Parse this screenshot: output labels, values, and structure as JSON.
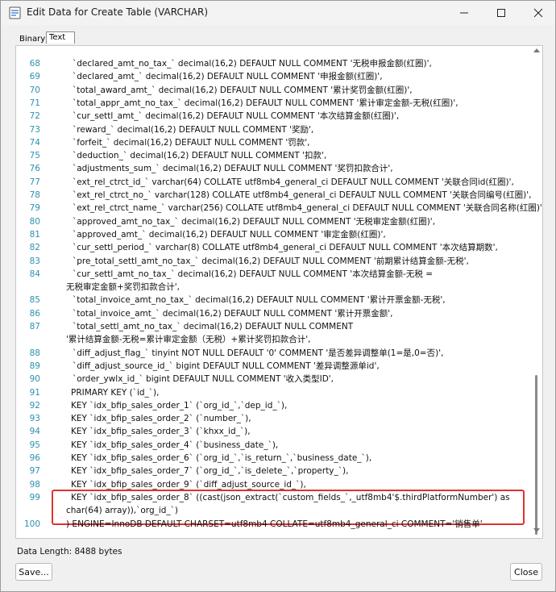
{
  "window": {
    "title": "Edit Data for Create Table (VARCHAR)"
  },
  "tabs": [
    {
      "label": "Binary"
    },
    {
      "label": "Text"
    }
  ],
  "lines": [
    {
      "num": "68",
      "text": "`declared_amt_no_tax_` decimal(16,2) DEFAULT NULL COMMENT '无税申报金额(红圈)',"
    },
    {
      "num": "69",
      "text": "`declared_amt_` decimal(16,2) DEFAULT NULL COMMENT '申报金额(红圈)',"
    },
    {
      "num": "70",
      "text": "`total_award_amt_` decimal(16,2) DEFAULT NULL COMMENT '累计奖罚金额(红圈)',"
    },
    {
      "num": "71",
      "text": "`total_appr_amt_no_tax_` decimal(16,2) DEFAULT NULL COMMENT '累计审定金额-无税(红圈)',"
    },
    {
      "num": "72",
      "text": "`cur_settl_amt_` decimal(16,2) DEFAULT NULL COMMENT '本次结算金额(红圈)',"
    },
    {
      "num": "73",
      "text": "`reward_` decimal(16,2) DEFAULT NULL COMMENT '奖励',"
    },
    {
      "num": "74",
      "text": "`forfeit_` decimal(16,2) DEFAULT NULL COMMENT '罚款',"
    },
    {
      "num": "75",
      "text": "`deduction_` decimal(16,2) DEFAULT NULL COMMENT '扣款',"
    },
    {
      "num": "76",
      "text": "`adjustments_sum_` decimal(16,2) DEFAULT NULL COMMENT '奖罚扣款合计',"
    },
    {
      "num": "77",
      "text": "`ext_rel_ctrct_id_` varchar(64) COLLATE utf8mb4_general_ci DEFAULT NULL COMMENT '关联合同id(红圈)',"
    },
    {
      "num": "78",
      "text": "`ext_rel_ctrct_no_` varchar(128) COLLATE utf8mb4_general_ci DEFAULT NULL COMMENT '关联合同编号(红圈)',"
    },
    {
      "num": "79",
      "text": "`ext_rel_ctrct_name_` varchar(256) COLLATE utf8mb4_general_ci DEFAULT NULL COMMENT '关联合同名称(红圈)',"
    },
    {
      "num": "80",
      "text": "`approved_amt_no_tax_` decimal(16,2) DEFAULT NULL COMMENT '无税审定金额(红圈)',"
    },
    {
      "num": "81",
      "text": "`approved_amt_` decimal(16,2) DEFAULT NULL COMMENT '审定金额(红圈)',"
    },
    {
      "num": "82",
      "text": "`cur_settl_period_` varchar(8) COLLATE utf8mb4_general_ci DEFAULT NULL COMMENT '本次结算期数',"
    },
    {
      "num": "83",
      "text": "`pre_total_settl_amt_no_tax_` decimal(16,2) DEFAULT NULL COMMENT '前期累计结算金额-无税',"
    },
    {
      "num": "84",
      "text": "`cur_settl_amt_no_tax_` decimal(16,2) DEFAULT NULL COMMENT '本次结算金额-无税 ="
    },
    {
      "num": "",
      "text": "无税审定金额+奖罚扣款合计',"
    },
    {
      "num": "85",
      "text": "`total_invoice_amt_no_tax_` decimal(16,2) DEFAULT NULL COMMENT '累计开票金额-无税',"
    },
    {
      "num": "86",
      "text": "`total_invoice_amt_` decimal(16,2) DEFAULT NULL COMMENT '累计开票金额',"
    },
    {
      "num": "87",
      "text": "`total_settl_amt_no_tax_` decimal(16,2) DEFAULT NULL COMMENT"
    },
    {
      "num": "",
      "text": "'累计结算金额-无税=累计审定金额（无税）+累计奖罚扣款合计',"
    },
    {
      "num": "88",
      "text": "`diff_adjust_flag_` tinyint NOT NULL DEFAULT '0' COMMENT '是否差异调整单(1=是,0=否)',"
    },
    {
      "num": "89",
      "text": "`diff_adjust_source_id_` bigint DEFAULT NULL COMMENT '差异调整源单id',"
    },
    {
      "num": "90",
      "text": "`order_ywlx_id_` bigint DEFAULT NULL COMMENT '收入类型ID',"
    },
    {
      "num": "91",
      "text": "PRIMARY KEY (`id_`),"
    },
    {
      "num": "92",
      "text": "KEY `idx_bfip_sales_order_1` (`org_id_`,`dep_id_`),"
    },
    {
      "num": "93",
      "text": "KEY `idx_bfip_sales_order_2` (`number_`),"
    },
    {
      "num": "94",
      "text": "KEY `idx_bfip_sales_order_3` (`khxx_id_`),"
    },
    {
      "num": "95",
      "text": "KEY `idx_bfip_sales_order_4` (`business_date_`),"
    },
    {
      "num": "96",
      "text": "KEY `idx_bfip_sales_order_6` (`org_id_`,`is_return_`,`business_date_`),"
    },
    {
      "num": "97",
      "text": "KEY `idx_bfip_sales_order_7` (`org_id_`,`is_delete_`,`property_`),"
    },
    {
      "num": "98",
      "text": "KEY `idx_bfip_sales_order_9` (`diff_adjust_source_id_`),"
    },
    {
      "num": "99",
      "text": "KEY `idx_bfip_sales_order_8` ((cast(json_extract(`custom_fields_`,_utf8mb4'$.thirdPlatformNumber') as"
    },
    {
      "num": "",
      "text": "char(64) array)),`org_id_`)"
    },
    {
      "num": "100",
      "text": ") ENGINE=InnoDB DEFAULT CHARSET=utf8mb4 COLLATE=utf8mb4_general_ci COMMENT='销售单'"
    }
  ],
  "footer": {
    "data_length": "Data Length: 8488 bytes",
    "save_label": "Save...",
    "close_label": "Close"
  },
  "colors": {
    "line_number": "#2b91af",
    "highlight": "#e0322e"
  }
}
